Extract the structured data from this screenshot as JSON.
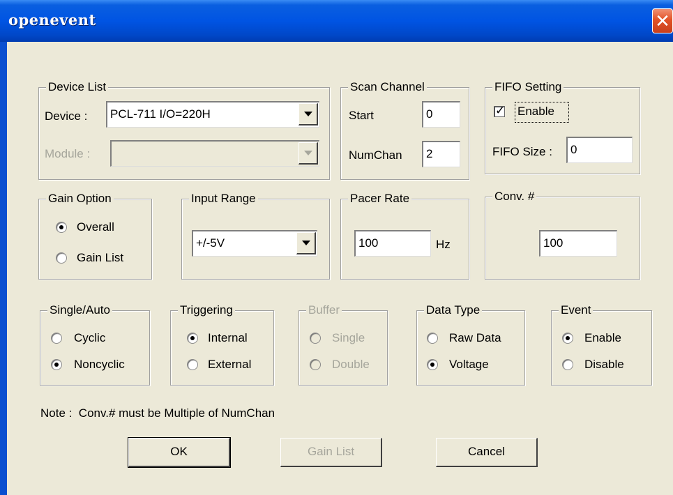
{
  "window": {
    "title": "openevent",
    "close_icon": "✕"
  },
  "device_list": {
    "legend": "Device List",
    "device_label": "Device :",
    "device_value": "PCL-711 I/O=220H",
    "module_label": "Module :",
    "module_value": ""
  },
  "scan_channel": {
    "legend": "Scan Channel",
    "start_label": "Start",
    "start_value": "0",
    "numchan_label": "NumChan",
    "numchan_value": "2"
  },
  "fifo": {
    "legend": "FIFO Setting",
    "enable_label": "Enable",
    "enable_checked": true,
    "size_label": "FIFO Size :",
    "size_value": "0"
  },
  "gain_option": {
    "legend": "Gain Option",
    "options": [
      "Overall",
      "Gain List"
    ],
    "selected": "Overall"
  },
  "input_range": {
    "legend": "Input Range",
    "value": "+/-5V"
  },
  "pacer_rate": {
    "legend": "Pacer Rate",
    "value": "100",
    "unit": "Hz"
  },
  "conv": {
    "legend": "Conv. #",
    "value": "100"
  },
  "single_auto": {
    "legend": "Single/Auto",
    "options": [
      "Cyclic",
      "Noncyclic"
    ],
    "selected": "Noncyclic"
  },
  "triggering": {
    "legend": "Triggering",
    "options": [
      "Internal",
      "External"
    ],
    "selected": "Internal"
  },
  "buffer": {
    "legend": "Buffer",
    "options": [
      "Single",
      "Double"
    ],
    "enabled": false
  },
  "data_type": {
    "legend": "Data Type",
    "options": [
      "Raw Data",
      "Voltage"
    ],
    "selected": "Voltage"
  },
  "event": {
    "legend": "Event",
    "options": [
      "Enable",
      "Disable"
    ],
    "selected": "Enable"
  },
  "note": "Note :  Conv.# must be Multiple of NumChan",
  "buttons": {
    "ok": "OK",
    "gain_list": "Gain List",
    "cancel": "Cancel"
  }
}
